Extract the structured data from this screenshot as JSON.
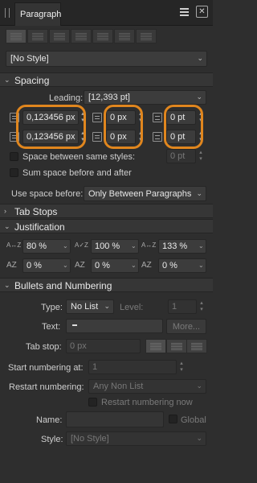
{
  "header": {
    "tab_label": "Paragraph"
  },
  "style_select": {
    "value": "[No Style]"
  },
  "spacing": {
    "title": "Spacing",
    "leading_label": "Leading:",
    "leading_value": "[12,393 pt]",
    "left_indent": "0,123456 px",
    "first_line_indent": "0,123456 px",
    "right_indent": "0 px",
    "right_indent_2": "0 px",
    "space_before": "0 pt",
    "space_after": "0 pt",
    "space_between_label": "Space between same styles:",
    "space_between_value": "0 pt",
    "sum_space_label": "Sum space before and after",
    "use_space_label": "Use space before:",
    "use_space_value": "Only Between Paragraphs"
  },
  "tab_stops": {
    "title": "Tab Stops"
  },
  "justification": {
    "title": "Justification",
    "word_spacing_min": "80 %",
    "word_spacing_desired": "100 %",
    "word_spacing_max": "133 %",
    "letter_spacing_min": "0 %",
    "letter_spacing_desired": "0 %",
    "letter_spacing_max": "0 %"
  },
  "bullets": {
    "title": "Bullets and Numbering",
    "type_label": "Type:",
    "type_value": "No List",
    "level_label": "Level:",
    "level_value": "1",
    "text_label": "Text:",
    "more_label": "More...",
    "tab_stop_label": "Tab stop:",
    "tab_stop_value": "0 px",
    "start_label": "Start numbering at:",
    "start_value": "1",
    "restart_label": "Restart numbering:",
    "restart_value": "Any Non List",
    "restart_now_label": "Restart numbering now",
    "name_label": "Name:",
    "global_label": "Global",
    "style_label": "Style:",
    "style_value": "[No Style]"
  },
  "colors": {
    "highlight": "#e0861e",
    "panel": "#2e2e2e"
  }
}
